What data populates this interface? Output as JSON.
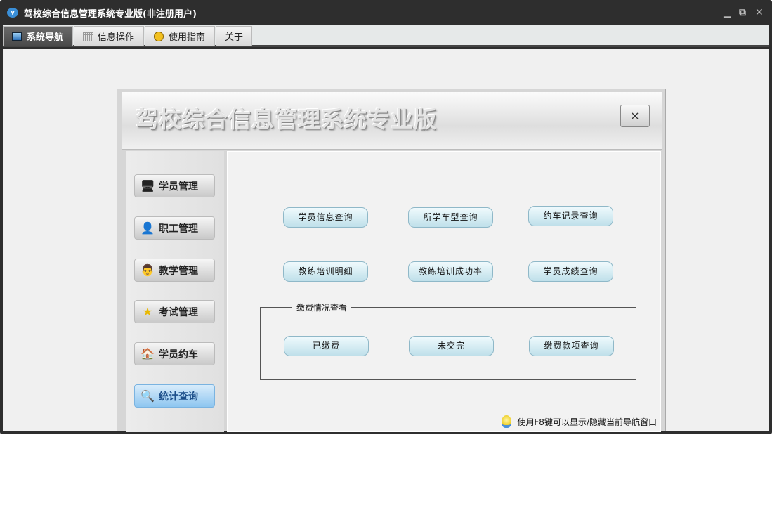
{
  "window": {
    "title": "驾校综合信息管理系统专业版(非注册用户)",
    "logo": "y"
  },
  "window_controls": {
    "minimize": "▁",
    "restore": "⧉",
    "close": "✕"
  },
  "tabs": [
    {
      "label": "系统导航",
      "icon": "monitor-icon"
    },
    {
      "label": "信息操作",
      "icon": "grid-icon"
    },
    {
      "label": "使用指南",
      "icon": "help-icon"
    },
    {
      "label": "关于"
    }
  ],
  "panel": {
    "title": "驾校综合信息管理系统专业版",
    "close": "×"
  },
  "sidebar": [
    {
      "label": "学员管理",
      "icon": "🖥"
    },
    {
      "label": "职工管理",
      "icon": "👤"
    },
    {
      "label": "教学管理",
      "icon": "👨"
    },
    {
      "label": "考试管理",
      "icon": "★"
    },
    {
      "label": "学员约车",
      "icon": "🏠"
    },
    {
      "label": "统计查询",
      "icon": "🔍"
    }
  ],
  "queries": [
    "学员信息查询",
    "所学车型查询",
    "约车记录查询",
    "教练培训明细",
    "教练培训成功率",
    "学员成绩查询"
  ],
  "fee": {
    "legend": "缴费情况查看",
    "buttons": [
      "已缴费",
      "未交完",
      "缴费款项查询"
    ]
  },
  "tip": "使用F8键可以显示/隐藏当前导航窗口"
}
